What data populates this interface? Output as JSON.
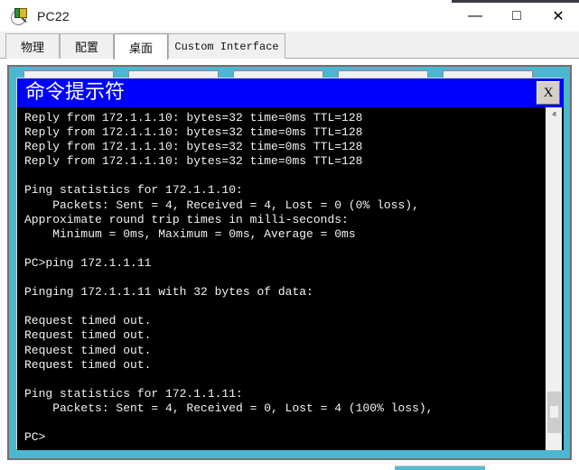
{
  "window": {
    "title": "PC22",
    "icon": "packet-tracer-icon",
    "controls": {
      "minimize": "—",
      "maximize": "□",
      "close": "✕"
    }
  },
  "tabs": [
    {
      "label": "物理",
      "active": false,
      "name": "tab-physical"
    },
    {
      "label": "配置",
      "active": false,
      "name": "tab-config"
    },
    {
      "label": "桌面",
      "active": true,
      "name": "tab-desktop"
    },
    {
      "label": "Custom Interface",
      "active": false,
      "name": "tab-custom"
    }
  ],
  "terminal": {
    "title": "命令提示符",
    "close_label": "X",
    "background": "#000000",
    "titlebar_color": "#0000FF",
    "text_color": "#F2F2F2",
    "lines": [
      "Reply from 172.1.1.10: bytes=32 time=0ms TTL=128",
      "Reply from 172.1.1.10: bytes=32 time=0ms TTL=128",
      "Reply from 172.1.1.10: bytes=32 time=0ms TTL=128",
      "Reply from 172.1.1.10: bytes=32 time=0ms TTL=128",
      "",
      "Ping statistics for 172.1.1.10:",
      "    Packets: Sent = 4, Received = 4, Lost = 0 (0% loss),",
      "Approximate round trip times in milli-seconds:",
      "    Minimum = 0ms, Maximum = 0ms, Average = 0ms",
      "",
      "PC>ping 172.1.1.11",
      "",
      "Pinging 172.1.1.11 with 32 bytes of data:",
      "",
      "Request timed out.",
      "Request timed out.",
      "Request timed out.",
      "Request timed out.",
      "",
      "Ping statistics for 172.1.1.11:",
      "    Packets: Sent = 4, Received = 0, Lost = 4 (100% loss),",
      "",
      "PC>"
    ]
  },
  "scrollbar": {
    "up_arrow": "ⱏ",
    "down_arrow": "ⱟ"
  },
  "colors": {
    "panel_accent": "#4CB7D0",
    "terminal_blue": "#0000FF",
    "frame_border": "#7B6C6C"
  }
}
